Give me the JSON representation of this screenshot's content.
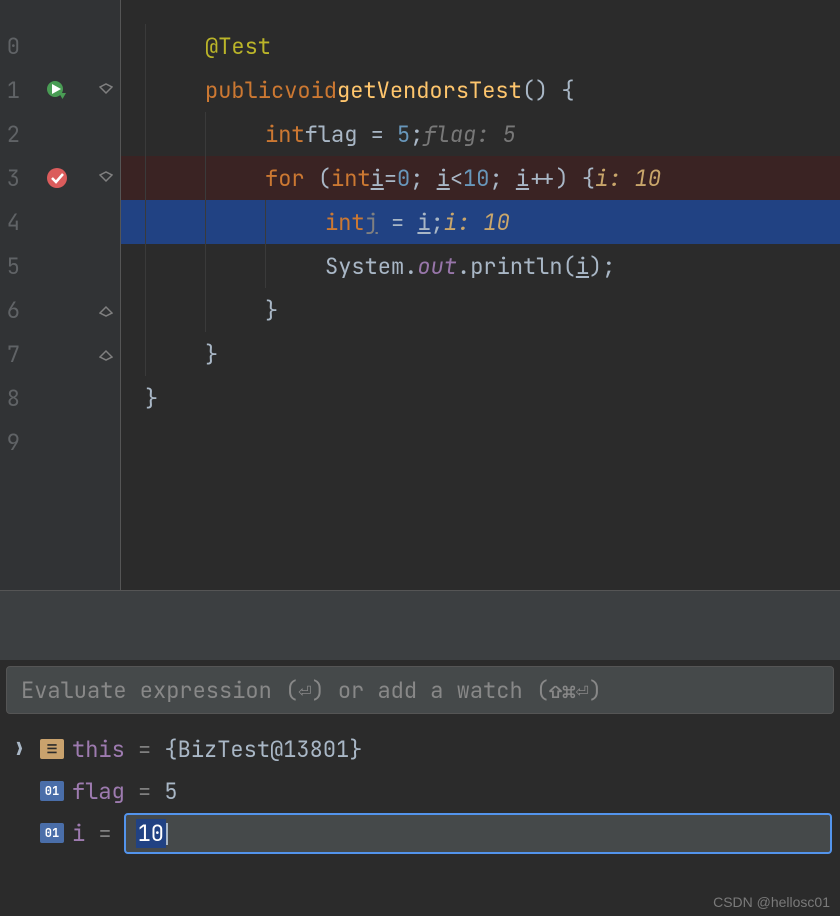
{
  "editor": {
    "lines": {
      "0": {
        "no": "0"
      },
      "1": {
        "no": "1"
      },
      "2": {
        "no": "2"
      },
      "3": {
        "no": "3"
      },
      "4": {
        "no": "4"
      },
      "5": {
        "no": "5"
      },
      "6": {
        "no": "6"
      },
      "7": {
        "no": "7"
      },
      "8": {
        "no": "8"
      },
      "9": {
        "no": "9"
      }
    },
    "code": {
      "annotation": "@Test",
      "kw_public": "public",
      "kw_void": "void",
      "method": "getVendorsTest",
      "parens_brace": "() {",
      "kw_int": "int",
      "var_flag": "flag",
      "eq": " = ",
      "num5": "5",
      "semi": ";",
      "hint_flag": "flag: 5",
      "kw_for": "for",
      "lparen": " (",
      "var_i": "i",
      "eq0": "=",
      "num0": "0",
      "semicolon": "; ",
      "lt": "<",
      "num10": "10",
      "inc": "++",
      "rparen_brace": ") {",
      "hint_i10": "i: 10",
      "var_j": "j",
      "eq_sp": " = ",
      "hint_i10b": "i: 10",
      "sys": "System",
      "dot": ".",
      "out": "out",
      "println": "println",
      "lparen2": "(",
      "rparen2": ");",
      "rbrace": "}",
      "rbrace2": "}",
      "rbrace3": "}"
    }
  },
  "debug": {
    "placeholder": "Evaluate expression (⏎) or add a watch (⇧⌘⏎)",
    "vars": {
      "this_name": "this",
      "this_val": "{BizTest@13801}",
      "flag_name": "flag",
      "flag_val": "5",
      "i_name": "i",
      "i_val": "10",
      "icon_obj": "☰",
      "icon_01": "01"
    }
  },
  "watermark": "CSDN @hellosc01"
}
